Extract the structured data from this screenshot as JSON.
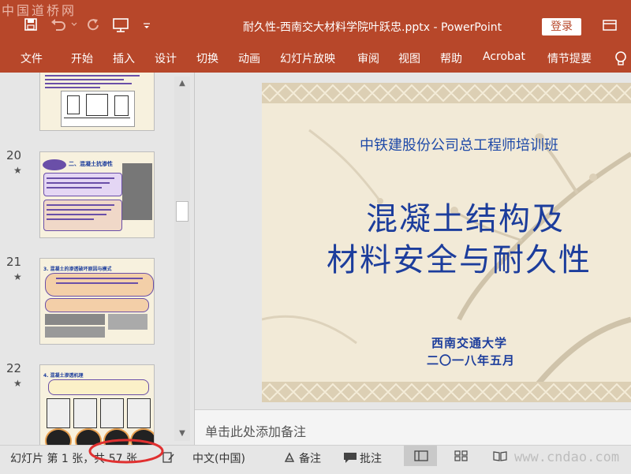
{
  "watermark_top": "中国道桥网",
  "title_bar": {
    "document_title": "耐久性-西南交大材料学院叶跃忠.pptx  -  PowerPoint",
    "login_label": "登录"
  },
  "ribbon_tabs": [
    "文件",
    "开始",
    "插入",
    "设计",
    "切换",
    "动画",
    "幻灯片放映",
    "审阅",
    "视图",
    "帮助",
    "Acrobat",
    "情节提要"
  ],
  "thumbnails": [
    {
      "number": "",
      "title": ""
    },
    {
      "number": "20",
      "title": "二、混凝土抗渗性"
    },
    {
      "number": "21",
      "title": "3. 混凝土的渗透破坏原因与模式"
    },
    {
      "number": "22",
      "title": "4. 混凝土渗透机理"
    }
  ],
  "slide": {
    "subtitle": "中铁建股份公司总工程师培训班",
    "title_line1": "混凝土结构及",
    "title_line2": "材料安全与耐久性",
    "organization": "西南交通大学",
    "date": "二〇一八年五月"
  },
  "notes_placeholder": "单击此处添加备注",
  "status_bar": {
    "slide_info": "幻灯片 第 1 张，共 57 张",
    "language": "中文(中国)",
    "notes_label": "备注",
    "comments_label": "批注"
  },
  "watermark_bottom": "www.cndao.com",
  "colors": {
    "accent": "#b7472a",
    "title_blue": "#1c3d9c",
    "highlight_ring": "#e03030"
  }
}
